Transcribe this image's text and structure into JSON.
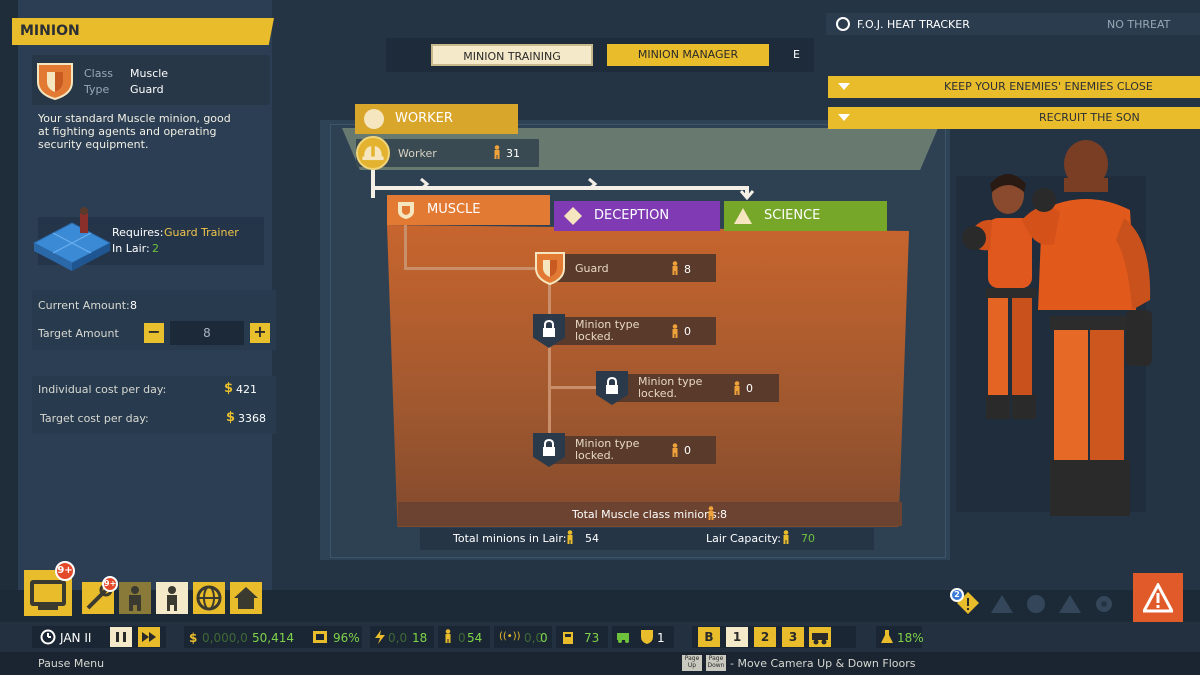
{
  "left_panel": {
    "header": "MINION",
    "class_key": "Class",
    "class_value": "Muscle",
    "type_key": "Type",
    "type_value": "Guard",
    "description": "Your standard Muscle minion, good at fighting agents and operating security equipment.",
    "requires_label": "Requires:",
    "requires_value": "Guard Trainer",
    "in_lair_label": "In Lair:",
    "in_lair_value": "2",
    "current_amount_label": "Current Amount:",
    "current_amount_value": "8",
    "target_amount_label": "Target Amount",
    "target_amount_value": "8",
    "minus_label": "−",
    "plus_label": "+",
    "individual_cost_label": "Individual cost per day:",
    "individual_cost_value": "421",
    "target_cost_label": "Target cost per day:",
    "target_cost_value": "3368",
    "currency_symbol": "$"
  },
  "tabs": {
    "training": "MINION TRAINING",
    "manager": "MINION MANAGER",
    "hotkey": "E"
  },
  "tree": {
    "worker_header": "WORKER",
    "worker_name": "Worker",
    "worker_count": "31",
    "muscle_header": "MUSCLE",
    "deception_header": "DECEPTION",
    "science_header": "SCIENCE",
    "nodes": [
      {
        "name": "Guard",
        "count": "8"
      },
      {
        "name": "Minion type locked.",
        "count": "0"
      },
      {
        "name": "Minion type locked.",
        "count": "0"
      },
      {
        "name": "Minion type locked.",
        "count": "0"
      }
    ],
    "total_muscle_label": "Total Muscle class minions:",
    "total_muscle_value": "8",
    "lair_total_label": "Total minions in Lair:",
    "lair_total_value": "54",
    "lair_capacity_label": "Lair Capacity:",
    "lair_capacity_value": "70"
  },
  "hud": {
    "heat_label": "F.O.J. HEAT TRACKER",
    "heat_status": "NO THREAT",
    "objectives": [
      "KEEP YOUR ENEMIES' ENEMIES CLOSE",
      "RECRUIT THE SON"
    ]
  },
  "dock": {
    "tv_badge": "9+",
    "tools_badge": "9+",
    "alert_badge": "2"
  },
  "status": {
    "date": "JAN II",
    "money_dim": "0,000,0",
    "money": "50,414",
    "efficiency": "96%",
    "power_dim": "0,0",
    "power": "18",
    "minions_dim": "0",
    "minions": "54",
    "signal_dim": "0,0",
    "signal": "0",
    "fuel": "73",
    "rooms": "1",
    "floors": [
      "B",
      "1",
      "2",
      "3"
    ],
    "research": "18%"
  },
  "footer": {
    "pause_menu": "Pause Menu",
    "key_up": "Page Up",
    "key_down": "Page Down",
    "camera_hint": "- Move Camera Up & Down Floors"
  },
  "colors": {
    "accent_yellow": "#e9bc2b",
    "muscle": "#e37a33",
    "deception": "#7f3ab4",
    "science": "#76a728",
    "positive_green": "#6ec23b"
  }
}
